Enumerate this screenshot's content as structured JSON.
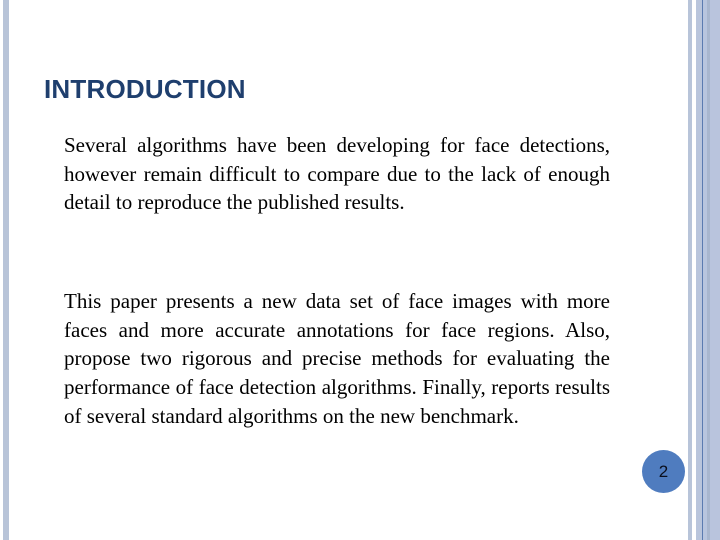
{
  "slide": {
    "title": "INTRODUCTION",
    "paragraphs": [
      "Several algorithms have been developing for face detections, however remain difficult to compare due to the lack of enough detail to reproduce the published results.",
      "This paper presents a new data set of face images with more faces and more accurate annotations for face regions. Also, propose two rigorous and precise methods for evaluating the performance of face detection algorithms. Finally, reports results of several standard algorithms on the new benchmark."
    ],
    "page_number": "2"
  },
  "theme": {
    "title_color": "#1f3f6e",
    "accent_color": "#4f7cbf",
    "decor_color": "#b8c4d8"
  }
}
